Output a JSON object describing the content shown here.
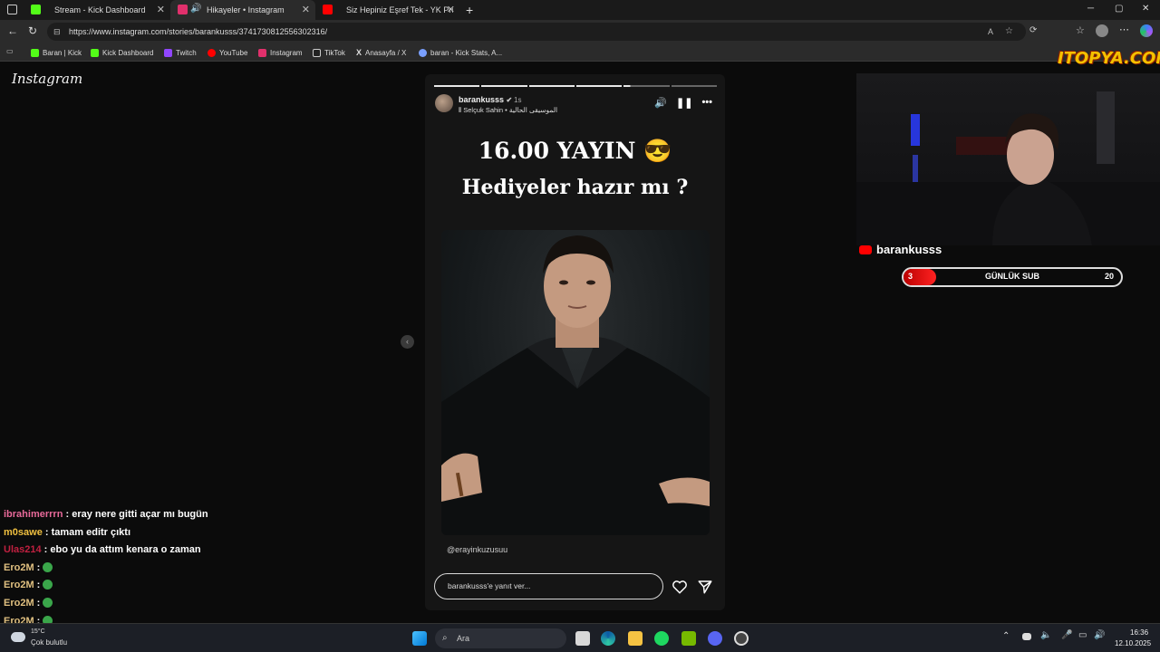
{
  "browser": {
    "tabs": [
      {
        "label": "Stream - Kick Dashboard",
        "color": "#53fc18"
      },
      {
        "label": "Hikayeler • Instagram",
        "color": "#e1306c"
      },
      {
        "label": "Siz Hepiniz Eşref Tek - YK Producti",
        "color": "#ff0000"
      }
    ],
    "new_tab": "+",
    "url": "https://www.instagram.com/stories/barankusss/3741730812556302316/",
    "bookmarks": [
      {
        "label": "Baran | Kick",
        "color": "#53fc18"
      },
      {
        "label": "Kick Dashboard",
        "color": "#53fc18"
      },
      {
        "label": "Twitch",
        "color": "#9146ff"
      },
      {
        "label": "YouTube",
        "color": "#ff0000"
      },
      {
        "label": "Instagram",
        "color": "#e1306c"
      },
      {
        "label": "TikTok",
        "color": "#ffffff"
      },
      {
        "label": "Anasayfa / X",
        "color": "#ffffff"
      },
      {
        "label": "baran - Kick Stats, A...",
        "color": "#7aa0ff"
      }
    ]
  },
  "instagram": {
    "logo": "Instagram",
    "story": {
      "username": "barankusss",
      "time": "1s",
      "music": "Selçuk Sahin • الموسيقى الحالية",
      "title_line1": "16.00 YAYIN 😎",
      "title_line2": "Hediyeler hazır mı ?",
      "mention": "@erayinkuzusuu",
      "reply_placeholder": "barankusss'e yanıt ver...",
      "segments_total": 6,
      "segments_done": 4,
      "current_segment_progress": 0.15
    }
  },
  "chat": [
    {
      "user": "ibrahimerrrn",
      "user_color": "#e86a9a",
      "message": "eray nere gitti açar mı bugün"
    },
    {
      "user": "m0sawe",
      "user_color": "#f0c040",
      "message": "tamam editr çıktı"
    },
    {
      "user": "Ulas214",
      "user_color": "#c02040",
      "message": "ebo yu da attım kenara o zaman"
    },
    {
      "user": "Ero2M",
      "user_color": "#e0c080",
      "message": ""
    },
    {
      "user": "Ero2M",
      "user_color": "#e0c080",
      "message": ""
    },
    {
      "user": "Ero2M",
      "user_color": "#e0c080",
      "message": ""
    },
    {
      "user": "Ero2M",
      "user_color": "#e0c080",
      "message": ""
    }
  ],
  "stream_overlay": {
    "channel": "barankusss",
    "sub_goal_label": "GÜNLÜK SUB",
    "sub_current": "3",
    "sub_goal": "20",
    "sub_progress": 0.15,
    "watermark": "ITOPYA.COM"
  },
  "taskbar": {
    "weather_temp": "15°C",
    "weather_text": "Çok bulutlu",
    "search_placeholder": "Ara",
    "time": "16:36",
    "date": "12.10.2025"
  }
}
